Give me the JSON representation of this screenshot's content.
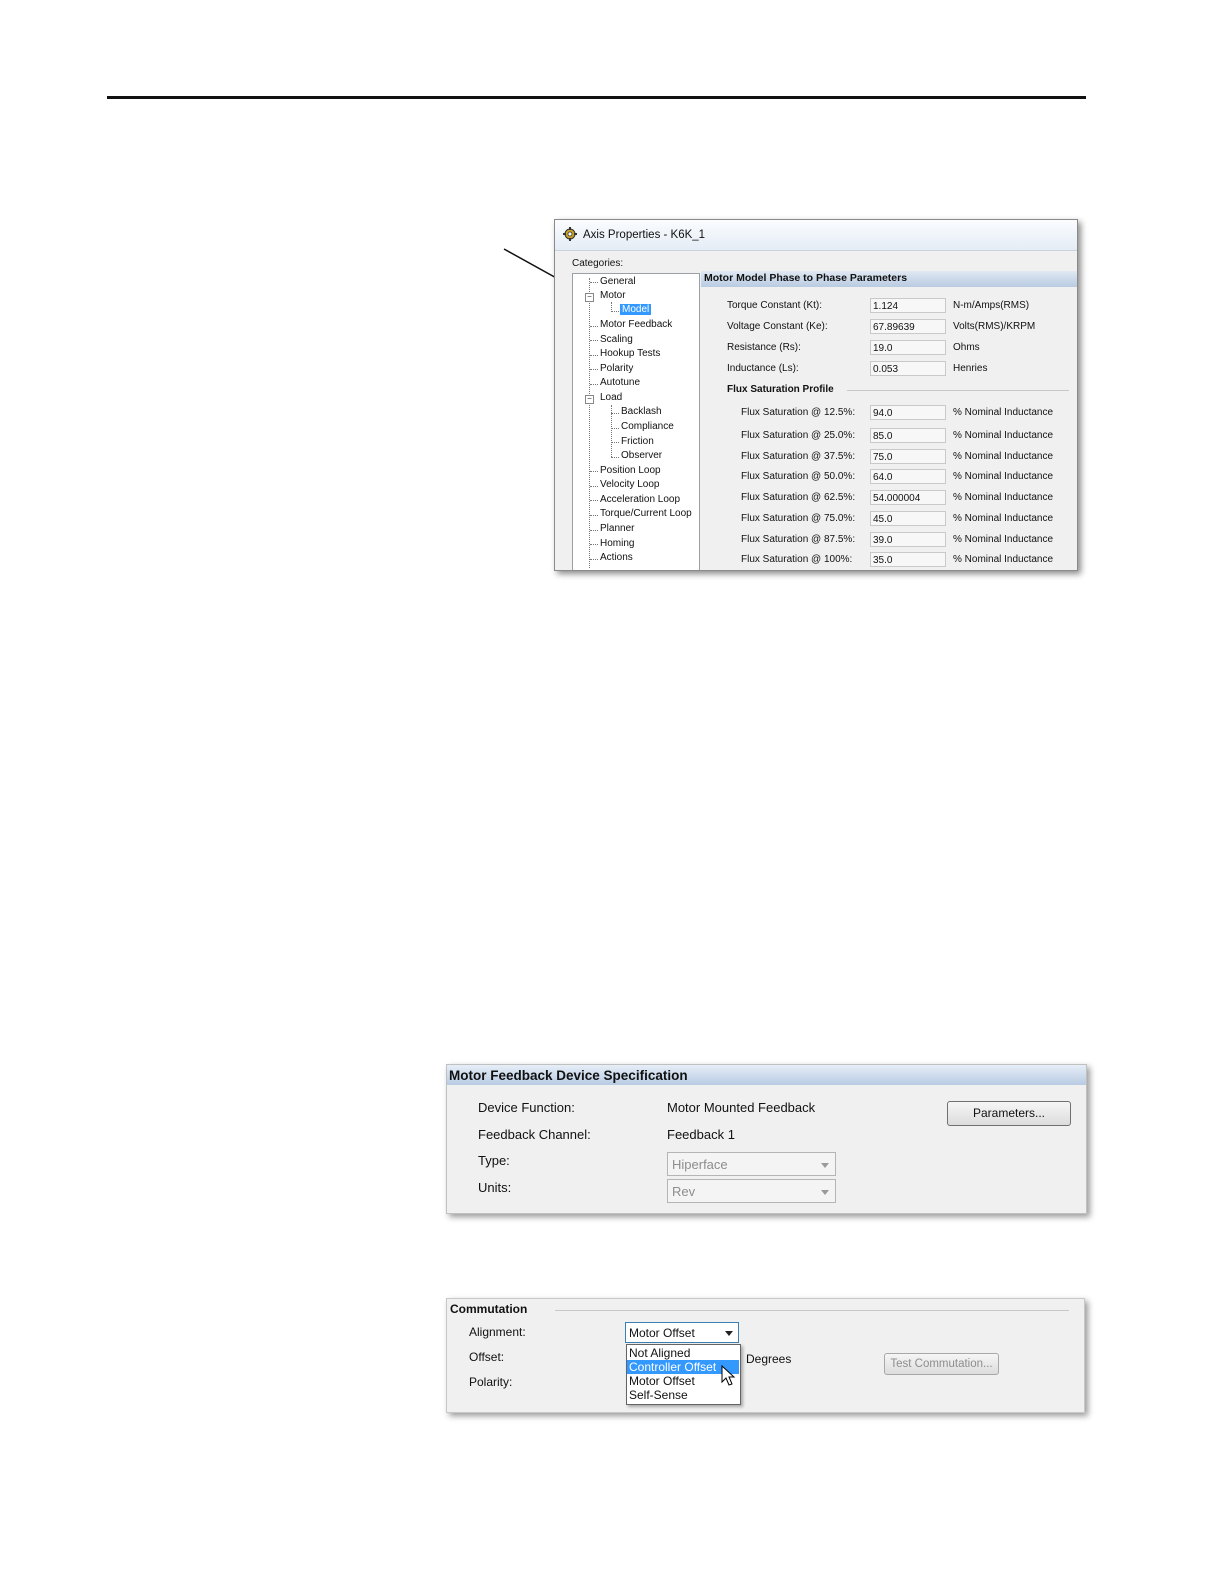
{
  "axis_window": {
    "title": "Axis Properties - K6K_1",
    "categories_label": "Categories:",
    "tree": [
      {
        "label": "General"
      },
      {
        "label": "Motor"
      },
      {
        "label": "Model"
      },
      {
        "label": "Motor Feedback"
      },
      {
        "label": "Scaling"
      },
      {
        "label": "Hookup Tests"
      },
      {
        "label": "Polarity"
      },
      {
        "label": "Autotune"
      },
      {
        "label": "Load"
      },
      {
        "label": "Backlash"
      },
      {
        "label": "Compliance"
      },
      {
        "label": "Friction"
      },
      {
        "label": "Observer"
      },
      {
        "label": "Position Loop"
      },
      {
        "label": "Velocity Loop"
      },
      {
        "label": "Acceleration Loop"
      },
      {
        "label": "Torque/Current Loop"
      },
      {
        "label": "Planner"
      },
      {
        "label": "Homing"
      },
      {
        "label": "Actions"
      }
    ],
    "panel_title": "Motor Model Phase to Phase Parameters",
    "params": [
      {
        "label": "Torque Constant (Kt):",
        "value": "1.124",
        "unit": "N-m/Amps(RMS)"
      },
      {
        "label": "Voltage Constant (Ke):",
        "value": "67.89639",
        "unit": "Volts(RMS)/KRPM"
      },
      {
        "label": "Resistance (Rs):",
        "value": "19.0",
        "unit": "Ohms"
      },
      {
        "label": "Inductance (Ls):",
        "value": "0.053",
        "unit": "Henries"
      }
    ],
    "flux_title": "Flux Saturation Profile",
    "flux": [
      {
        "label": "Flux Saturation @ 12.5%:",
        "value": "94.0",
        "unit": "% Nominal Inductance"
      },
      {
        "label": "Flux Saturation @ 25.0%:",
        "value": "85.0",
        "unit": "% Nominal Inductance"
      },
      {
        "label": "Flux Saturation @ 37.5%:",
        "value": "75.0",
        "unit": "% Nominal Inductance"
      },
      {
        "label": "Flux Saturation @ 50.0%:",
        "value": "64.0",
        "unit": "% Nominal Inductance"
      },
      {
        "label": "Flux Saturation @ 62.5%:",
        "value": "54.000004",
        "unit": "% Nominal Inductance"
      },
      {
        "label": "Flux Saturation @ 75.0%:",
        "value": "45.0",
        "unit": "% Nominal Inductance"
      },
      {
        "label": "Flux Saturation @ 87.5%:",
        "value": "39.0",
        "unit": "% Nominal Inductance"
      },
      {
        "label": "Flux Saturation @ 100%:",
        "value": "35.0",
        "unit": "% Nominal Inductance"
      }
    ]
  },
  "feedback_panel": {
    "title": "Motor Feedback Device Specification",
    "device_function_label": "Device Function:",
    "device_function_value": "Motor Mounted Feedback",
    "feedback_channel_label": "Feedback Channel:",
    "feedback_channel_value": "Feedback 1",
    "type_label": "Type:",
    "type_value": "Hiperface",
    "units_label": "Units:",
    "units_value": "Rev",
    "parameters_button": "Parameters..."
  },
  "commutation_panel": {
    "title": "Commutation",
    "alignment_label": "Alignment:",
    "alignment_value": "Motor Offset",
    "offset_label": "Offset:",
    "offset_unit": "Degrees",
    "polarity_label": "Polarity:",
    "options": [
      "Not Aligned",
      "Controller Offset",
      "Motor Offset",
      "Self-Sense"
    ],
    "highlighted_option": "Controller Offset",
    "test_button": "Test Commutation..."
  },
  "colors": {
    "selection": "#3399ff",
    "header_gradient": "#b9cbe1"
  }
}
